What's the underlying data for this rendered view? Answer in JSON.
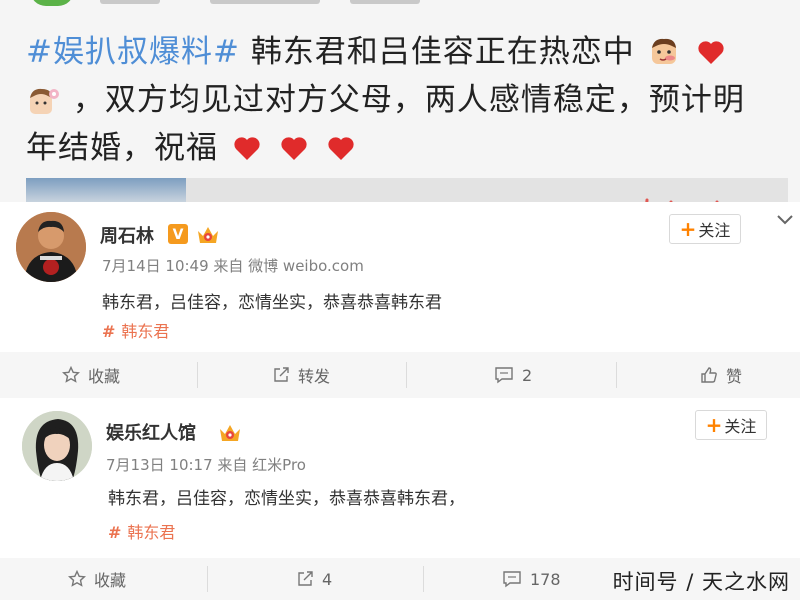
{
  "top_post": {
    "hashtag": "#娱扒叔爆料#",
    "line1_rest": "韩东君和吕佳容正在热恋中",
    "line2": "，双方均见过对方父母，两人感情稳定，预计明",
    "line3": "年结婚，祝福",
    "icons": [
      "man-emoji-icon",
      "heart-icon",
      "girl-emoji-icon"
    ],
    "colors": {
      "hashtag": "#4f8ed6",
      "heart": "#e02b2b"
    }
  },
  "comments": [
    {
      "name": "周石林",
      "verified": "V",
      "timestamp": "7月14日 10:49 来自 微博 weibo.com",
      "text": "韩东君，吕佳容，恋情坐实，恭喜恭喜韩东君",
      "topic": "韩东君",
      "follow_label": "关注",
      "actions": {
        "collect": "收藏",
        "repost": "转发",
        "comment": "2",
        "like": "赞"
      }
    },
    {
      "name": "娱乐红人馆",
      "timestamp": "7月13日 10:17 来自 红米Pro",
      "text": "韩东君，吕佳容，恋情坐实，恭喜恭喜韩东君，",
      "topic": "韩东君",
      "follow_label": "关注",
      "actions": {
        "collect": "收藏",
        "repost": "4",
        "comment": "178"
      }
    }
  ],
  "watermark": "时间号 / 天之水网",
  "colors": {
    "accent": "#ff8200",
    "topic": "#eb7350",
    "muted": "#808080"
  }
}
